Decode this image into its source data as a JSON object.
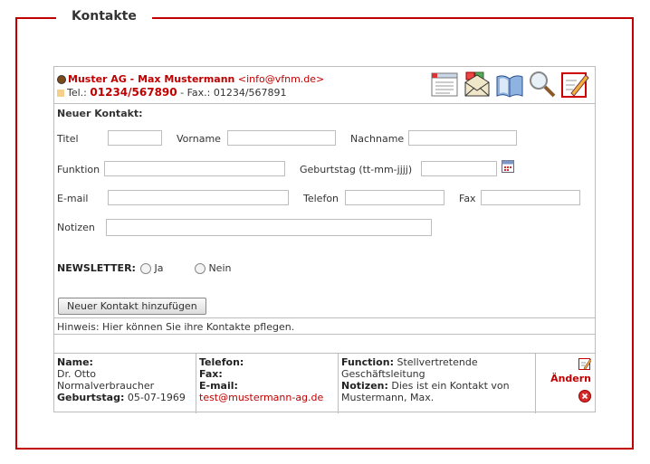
{
  "section": {
    "title": "Kontakte"
  },
  "company": {
    "name": "Muster AG - Max Mustermann",
    "email": "<info@vfnm.de>",
    "phone_label": "Tel.:",
    "phone": "01234/567890",
    "fax_text": "- Fax.: 01234/567891"
  },
  "toolbar": {
    "icons": [
      "list-icon",
      "mail-icon",
      "book-icon",
      "search-icon",
      "edit-icon"
    ]
  },
  "form": {
    "title": "Neuer Kontakt:",
    "titel_label": "Titel",
    "vorname_label": "Vorname",
    "nachname_label": "Nachname",
    "funktion_label": "Funktion",
    "geburtstag_label": "Geburtstag (tt-mm-jjjj)",
    "email_label": "E-mail",
    "telefon_label": "Telefon",
    "fax_label": "Fax",
    "notizen_label": "Notizen",
    "newsletter_label": "NEWSLETTER:",
    "newsletter_ja": "Ja",
    "newsletter_nein": "Nein",
    "submit_label": "Neuer Kontakt hinzufügen",
    "values": {
      "titel": "",
      "vorname": "",
      "nachname": "",
      "funktion": "",
      "geburtstag": "",
      "email": "",
      "telefon": "",
      "fax": "",
      "notizen": ""
    }
  },
  "hint": "Hinweis: Hier können Sie ihre Kontakte pflegen.",
  "contact": {
    "name_label": "Name:",
    "name": "Dr. Otto",
    "type": "Normalverbraucher",
    "birthday_label": "Geburtstag:",
    "birthday": "05-07-1969",
    "telefon_label": "Telefon:",
    "fax_label": "Fax:",
    "email_label": "E-mail:",
    "email": "test@mustermann-ag.de",
    "function_label": "Function:",
    "function": "Stellvertretende Geschäftsleitung",
    "notes_label": "Notizen:",
    "notes": "Dies ist ein Kontakt von Mustermann, Max.",
    "edit_label": "Ändern"
  }
}
